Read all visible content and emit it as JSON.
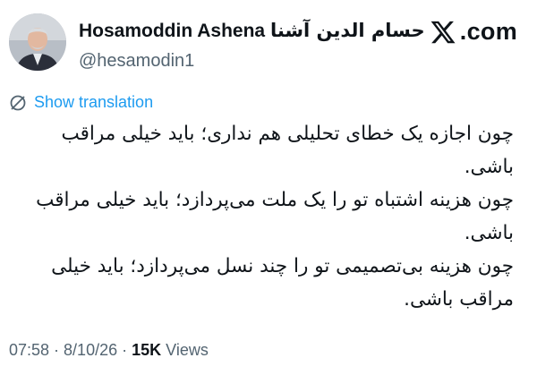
{
  "author": {
    "display_name_latin": "Hosamoddin Ashena",
    "display_name_persian": "حسام الدین آشنا",
    "handle": "@hesamodin1",
    "avatar_icon": "profile-photo"
  },
  "brand": {
    "label": ".com",
    "icon": "x-logo-icon"
  },
  "translation": {
    "label": "Show translation",
    "icon": "translate-globe-icon",
    "color": "#1d9bf0"
  },
  "tweet": {
    "lines": [
      "چون اجازه یک خطای تحلیلی هم نداری؛ باید خیلی مراقب باشی.",
      "چون هزینه اشتباه تو را یک ملت می‌پردازد؛ باید خیلی مراقب باشی.",
      "چون هزینه بی‌تصمیمی تو را چند نسل می‌پردازد؛ باید خیلی مراقب باشی."
    ]
  },
  "meta": {
    "time": "07:58",
    "separator": " · ",
    "date": "8/10/26",
    "views_count": "15K",
    "views_label": " Views"
  }
}
